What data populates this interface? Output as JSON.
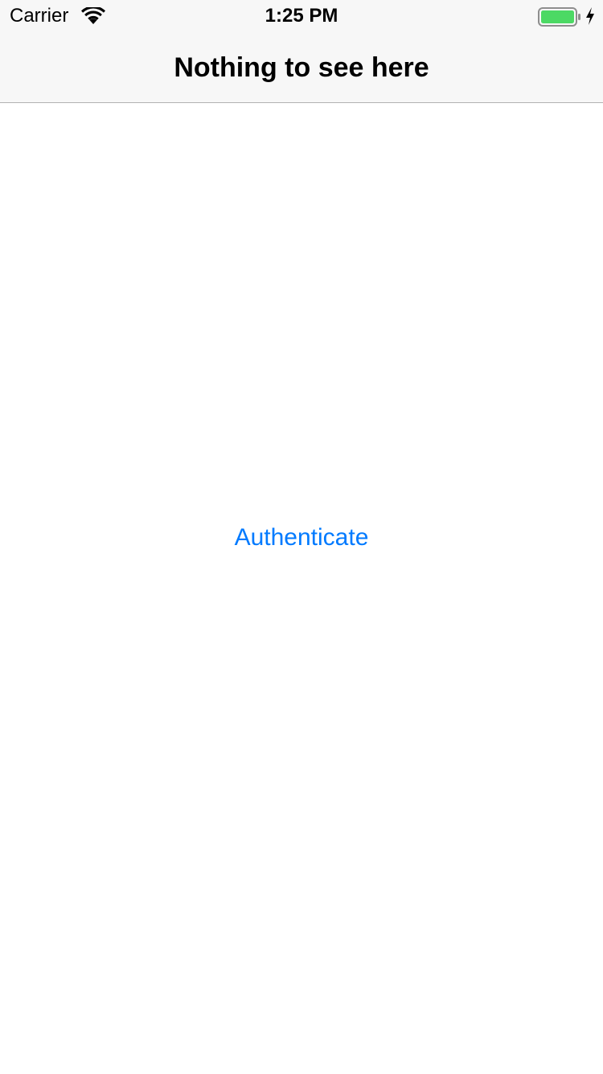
{
  "status_bar": {
    "carrier": "Carrier",
    "time": "1:25 PM",
    "wifi_icon": "wifi-icon",
    "battery_icon": "battery-icon",
    "charging_icon": "charging-bolt-icon",
    "battery_level": 1.0,
    "battery_color": "#4cd964"
  },
  "nav_bar": {
    "title": "Nothing to see here"
  },
  "main": {
    "authenticate_label": "Authenticate"
  },
  "colors": {
    "accent": "#007aff",
    "nav_background": "#f7f7f7",
    "nav_border": "#b2b2b2"
  }
}
